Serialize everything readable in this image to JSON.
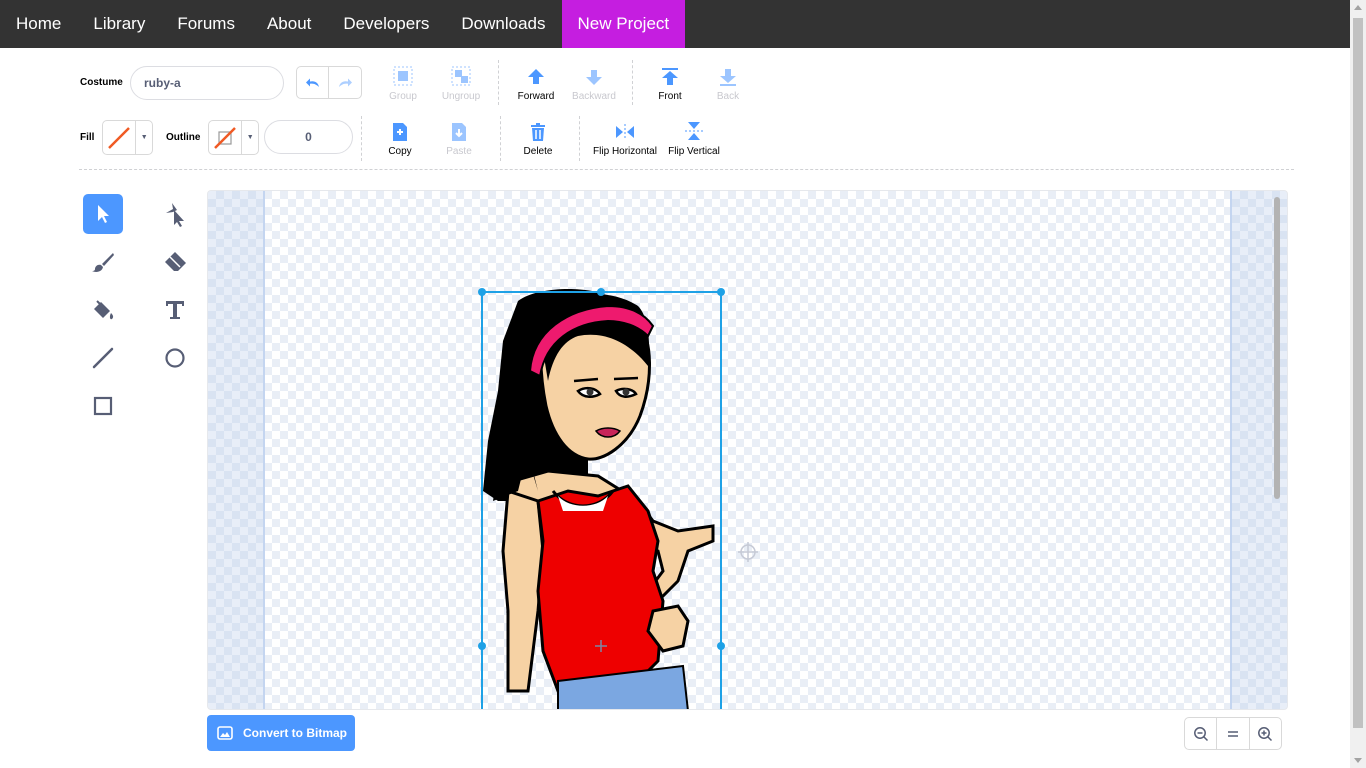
{
  "nav": {
    "items": [
      {
        "label": "Home"
      },
      {
        "label": "Library"
      },
      {
        "label": "Forums"
      },
      {
        "label": "About"
      },
      {
        "label": "Developers"
      },
      {
        "label": "Downloads"
      },
      {
        "label": "New Project"
      }
    ]
  },
  "costume": {
    "label": "Costume",
    "value": "ruby-a"
  },
  "fill": {
    "label": "Fill",
    "color": "none"
  },
  "outline": {
    "label": "Outline",
    "color": "none",
    "width": "0"
  },
  "toolbar": {
    "group": "Group",
    "ungroup": "Ungroup",
    "forward": "Forward",
    "backward": "Backward",
    "front": "Front",
    "back": "Back",
    "copy": "Copy",
    "paste": "Paste",
    "delete": "Delete",
    "flip_horizontal": "Flip Horizontal",
    "flip_vertical": "Flip Vertical"
  },
  "tools": [
    {
      "name": "select",
      "icon": "arrow-cursor-icon",
      "active": true
    },
    {
      "name": "reshape",
      "icon": "reshape-icon",
      "active": false
    },
    {
      "name": "brush",
      "icon": "brush-icon",
      "active": false
    },
    {
      "name": "eraser",
      "icon": "eraser-icon",
      "active": false
    },
    {
      "name": "fill",
      "icon": "paint-bucket-icon",
      "active": false
    },
    {
      "name": "text",
      "icon": "text-icon",
      "active": false
    },
    {
      "name": "line",
      "icon": "line-icon",
      "active": false
    },
    {
      "name": "circle",
      "icon": "circle-icon",
      "active": false
    },
    {
      "name": "rectangle",
      "icon": "rectangle-icon",
      "active": false
    }
  ],
  "convert": {
    "label": "Convert to Bitmap"
  },
  "colors": {
    "nav_bg": "#333333",
    "nav_active": "#c51ee0",
    "accent": "#4c97ff",
    "selection": "#1ea1e6"
  }
}
